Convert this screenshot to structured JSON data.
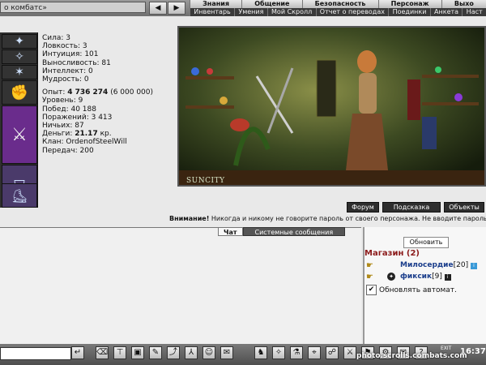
{
  "window": {
    "title_fragment": "о комбатс»"
  },
  "nav": {
    "back_glyph": "◀",
    "forward_glyph": "▶"
  },
  "menu": {
    "top": [
      "Знания",
      "Общение",
      "Безопасность",
      "Персонаж",
      "Выхо"
    ],
    "bottom": [
      "Инвентарь",
      "Умения",
      "Мой Скролл",
      "Отчет о переводах",
      "Поединки",
      "Анкета",
      "Наст"
    ]
  },
  "stats": {
    "sila": "Сила: 3",
    "lovkost": "Ловкость: 3",
    "intuition": "Интуиция: 101",
    "endurance": "Выносливость: 81",
    "intellect": "Интеллект: 0",
    "wisdom": "Мудрость: 0",
    "exp_prefix": "Опыт: ",
    "exp_value": "4 736 274",
    "exp_next": " (6 000 000)",
    "level": "Уровень: 9",
    "wins": "Побед: 40 188",
    "losses": "Поражений: 3 413",
    "draws": "Ничьих: 87",
    "money_prefix": "Деньги: ",
    "money_value": "21.17",
    "money_suffix": " кр.",
    "clan": "Клан: OrdenofSteelWill",
    "transfers": "Передач: 200"
  },
  "scene": {
    "label": "SUNCITY"
  },
  "buttons": {
    "forum": "Форум",
    "hint": "Подсказка",
    "objects": "Объекты"
  },
  "warning": {
    "bold": "Внимание!",
    "text": " Никогда и никому не говорите пароль от своего персонажа. Не вводите пароль"
  },
  "chat": {
    "tab_chat": "Чат",
    "tab_system": "Системные сообщения"
  },
  "right_panel": {
    "refresh": "Обновить",
    "shop": "Магазин (2)",
    "users": [
      {
        "name": "Милосердие",
        "level": "[20]"
      },
      {
        "name": "фиксик",
        "level": "[9]"
      }
    ],
    "auto_refresh": "Обновлять автомат."
  },
  "bottom": {
    "exit": "EXIT",
    "clock": "16:37",
    "watermark": "photo.scrolls.combats.com"
  },
  "colors": {
    "shop_red": "#8b1a1a",
    "user_blue": "#1a3d8b",
    "toolbar_dark": "#4e4e4e"
  }
}
